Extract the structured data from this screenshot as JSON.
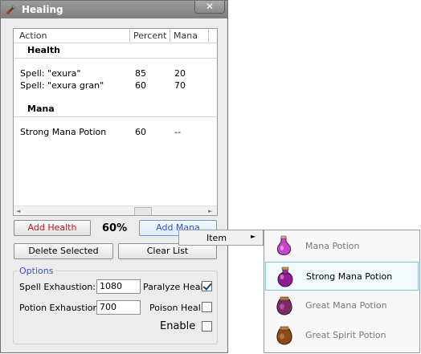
{
  "window": {
    "title": "Healing",
    "close_glyph": "✕"
  },
  "list": {
    "columns": [
      "Action",
      "Percent",
      "Mana"
    ],
    "groups": [
      {
        "name": "Health",
        "rows": [
          {
            "action": "Spell: \"exura\"",
            "percent": "85",
            "mana": "20"
          },
          {
            "action": "Spell: \"exura gran\"",
            "percent": "60",
            "mana": "70"
          }
        ]
      },
      {
        "name": "Mana",
        "rows": [
          {
            "action": "Strong Mana Potion",
            "percent": "60",
            "mana": "--"
          }
        ]
      }
    ],
    "scroll_left": "◄",
    "scroll_right": "►"
  },
  "buttons": {
    "add_health": "Add Health",
    "percent": "60%",
    "add_mana": "Add Mana",
    "delete_selected": "Delete Selected",
    "clear_list": "Clear List"
  },
  "options": {
    "legend": "Options",
    "spell_exhaustion_label": "Spell Exhaustion:",
    "spell_exhaustion_value": "1080",
    "potion_exhaustion_label": "Potion Exhaustion:",
    "potion_exhaustion_value": "700",
    "paralyze_heal_label": "Paralyze Heal",
    "paralyze_heal_checked": true,
    "poison_heal_label": "Poison Heal",
    "poison_heal_checked": false,
    "enable_label": "Enable",
    "enable_checked": false
  },
  "context_menu": {
    "item_label": "Item",
    "arrow": "►"
  },
  "submenu": {
    "items": [
      {
        "label": "Mana Potion",
        "icon": "mana-potion-icon",
        "color": "#c040c0"
      },
      {
        "label": "Strong Mana Potion",
        "icon": "strong-mana-potion-icon",
        "color": "#8a1f8a",
        "selected": true
      },
      {
        "label": "Great Mana Potion",
        "icon": "great-mana-potion-icon",
        "color": "#7a2a6a"
      },
      {
        "label": "Great Spirit Potion",
        "icon": "great-spirit-potion-icon",
        "color": "#8b4a1a"
      }
    ]
  },
  "colors": {
    "title_bar": "#8a8a8a",
    "add_health_text": "#c0161e",
    "add_mana_text": "#2a59c4",
    "legend_text": "#2a59c4",
    "selected_border": "#7fc3e0"
  }
}
